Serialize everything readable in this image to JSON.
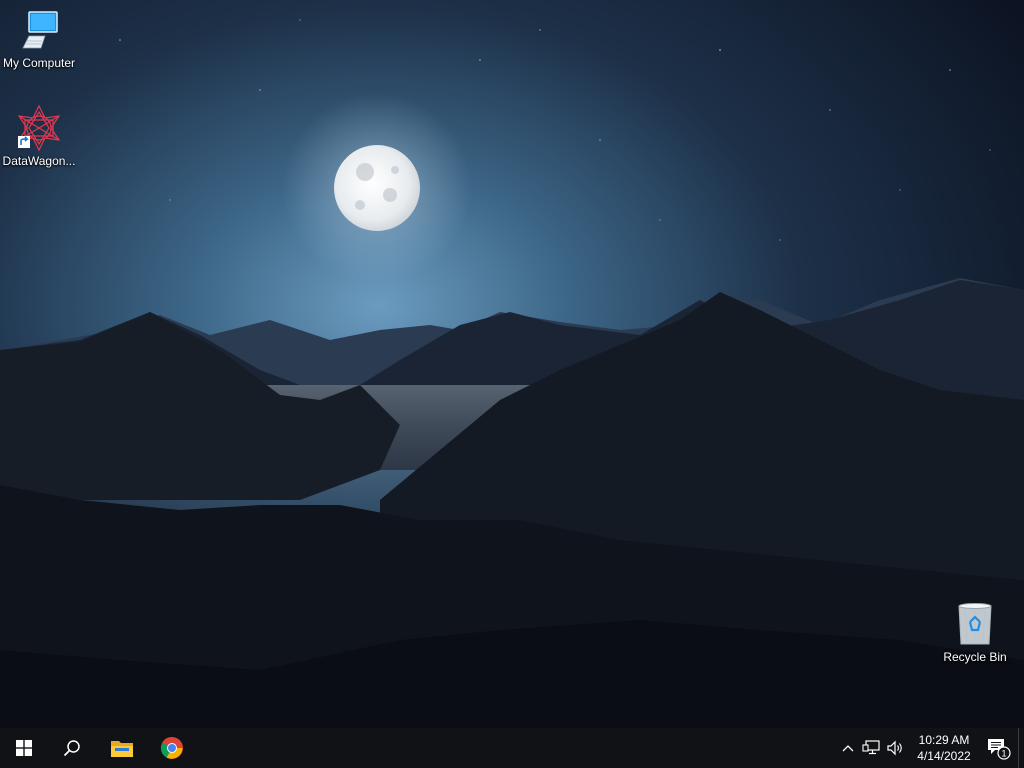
{
  "desktop": {
    "icons": [
      {
        "label": "My Computer",
        "icon": "computer-icon"
      },
      {
        "label": "DataWagon...",
        "icon": "datawagon-app-icon",
        "shortcut": true
      },
      {
        "label": "Recycle Bin",
        "icon": "recycle-bin-icon"
      }
    ]
  },
  "taskbar": {
    "buttons": [
      {
        "icon": "windows-start-icon"
      },
      {
        "icon": "search-icon"
      },
      {
        "icon": "file-explorer-icon"
      },
      {
        "icon": "chrome-icon"
      }
    ],
    "tray": {
      "icons": [
        "chevron-up-icon",
        "network-icon",
        "volume-icon"
      ],
      "time": "10:29 AM",
      "date": "4/14/2022",
      "notification_count": "1"
    }
  },
  "colors": {
    "taskbar_bg": "#101216",
    "sky_top": "#0d1424",
    "sky_glow": "#5f8eb3",
    "accent_blue": "#1da1f2"
  }
}
